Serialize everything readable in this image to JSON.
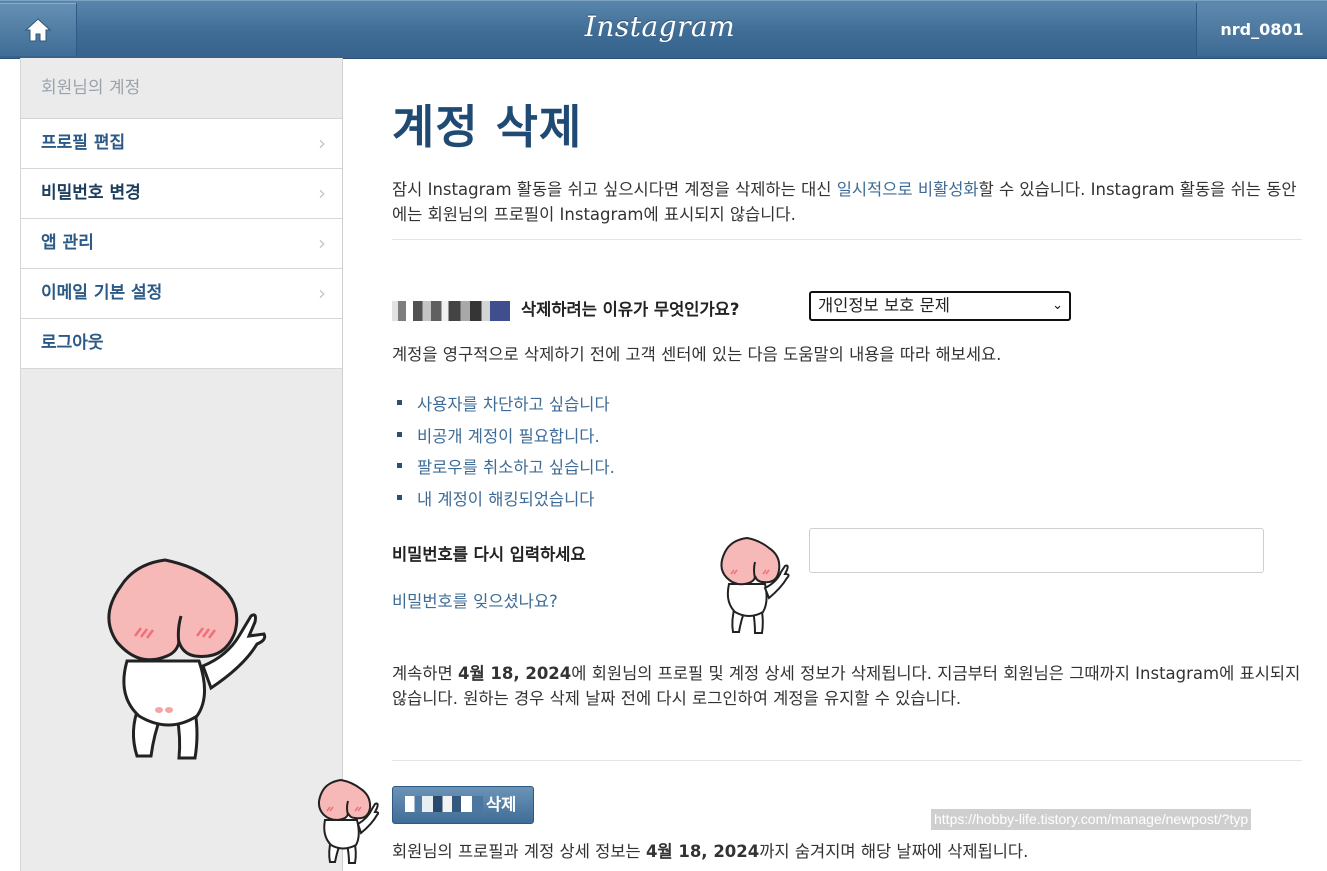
{
  "header": {
    "logo_text": "Instagram",
    "username": "nrd_0801",
    "home_icon": "home-icon"
  },
  "sidebar": {
    "heading": "회원님의 계정",
    "items": [
      {
        "label": "프로필 편집"
      },
      {
        "label": "비밀번호 변경"
      },
      {
        "label": "앱 관리"
      },
      {
        "label": "이메일 기본 설정"
      },
      {
        "label": "로그아웃"
      }
    ],
    "chevron": "›"
  },
  "main": {
    "title": "계정 삭제",
    "intro_before": "잠시 Instagram 활동을 쉬고 싶으시다면 계정을 삭제하는 대신 ",
    "intro_link": "일시적으로 비활성화",
    "intro_after": "할 수 있습니다. Instagram 활동을 쉬는 동안에는 회원님의 프로필이 Instagram에 표시되지 않습니다.",
    "reason_label": "삭제하려는 이유가 무엇인가요?",
    "reason_selected": "개인정보 보호 문제",
    "help_text": "계정을 영구적으로 삭제하기 전에 고객 센터에 있는 다음 도움말의 내용을 따라 해보세요.",
    "help_links": [
      "사용자를 차단하고 싶습니다",
      "비공개 계정이 필요합니다.",
      "팔로우를 취소하고 싶습니다.",
      "내 계정이 해킹되었습니다"
    ],
    "password_label": "비밀번호를 다시 입력하세요",
    "password_value": "",
    "forgot_password": "비밀번호를 잊으셨나요?",
    "notice_1": "계속하면 ",
    "notice_date": "4월 18, 2024",
    "notice_2": "에 회원님의 프로필 및 계정 상세 정보가 삭제됩니다. 지금부터 회원님은 그때까지 Instagram에 표시되지 않습니다. 원하는 경우 삭제 날짜 전에 다시 로그인하여 계정을 유지할 수 있습니다.",
    "delete_button": "삭제",
    "final_1": "회원님의 프로필과 계정 상세 정보는 ",
    "final_date": "4월 18, 2024",
    "final_2": "까지 숨겨지며 해당 날짜에 삭제됩니다."
  },
  "overlay_url": "https://hobby-life.tistory.com/manage/newpost/?typ",
  "colors": {
    "header": "#3f6d96",
    "link": "#3e6c97",
    "title": "#1f4a73",
    "peach": "#f7b8b8"
  }
}
